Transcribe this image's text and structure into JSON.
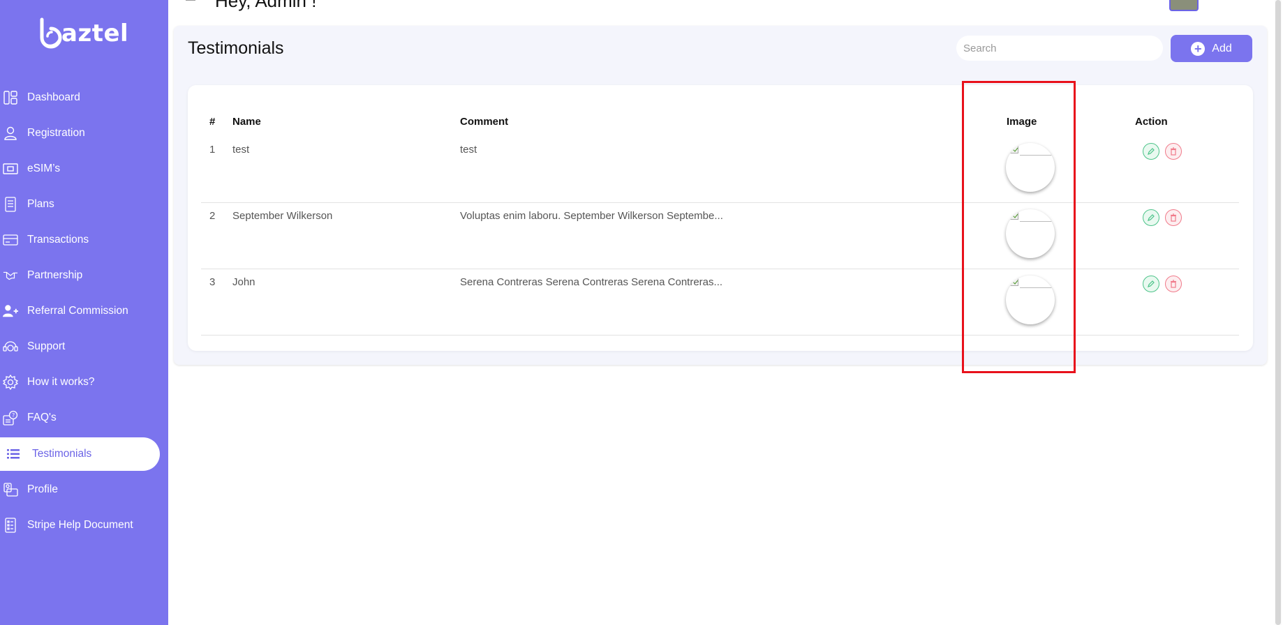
{
  "brand": {
    "name": "aztel",
    "accent": "#7b74ee"
  },
  "header": {
    "greeting": "Hey, Admin !"
  },
  "sidebar": {
    "items": [
      {
        "label": "Dashboard",
        "icon": "dashboard-icon"
      },
      {
        "label": "Registration",
        "icon": "user-icon"
      },
      {
        "label": "eSIM’s",
        "icon": "esim-icon"
      },
      {
        "label": "Plans",
        "icon": "plans-icon"
      },
      {
        "label": "Transactions",
        "icon": "card-icon"
      },
      {
        "label": "Partnership",
        "icon": "handshake-icon"
      },
      {
        "label": "Referral Commission",
        "icon": "user-plus-icon"
      },
      {
        "label": "Support",
        "icon": "headset-icon"
      },
      {
        "label": "How it works?",
        "icon": "gear-icon"
      },
      {
        "label": "FAQ's",
        "icon": "faq-icon"
      },
      {
        "label": "Testimonials",
        "icon": "list-icon",
        "active": true
      },
      {
        "label": "Profile",
        "icon": "profile-icon"
      },
      {
        "label": "Stripe Help Document",
        "icon": "document-icon"
      }
    ]
  },
  "main": {
    "title": "Testimonials",
    "search_placeholder": "Search",
    "add_label": "Add",
    "table": {
      "columns": [
        "#",
        "Name",
        "Comment",
        "Image",
        "Action"
      ],
      "rows": [
        {
          "num": "1",
          "name": "test",
          "comment": "test"
        },
        {
          "num": "2",
          "name": "September Wilkerson",
          "comment": "Voluptas enim laboru. September Wilkerson Septembe..."
        },
        {
          "num": "3",
          "name": "John",
          "comment": "Serena Contreras Serena Contreras Serena Contreras..."
        }
      ]
    }
  },
  "colors": {
    "highlight": "#e8111b",
    "edit": "#4cc389",
    "delete": "#f07a8a"
  }
}
